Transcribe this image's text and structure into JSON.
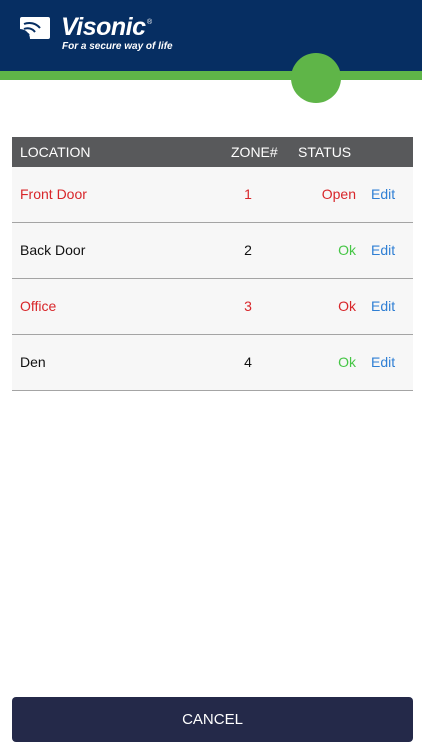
{
  "header": {
    "brand_name": "Visonic",
    "brand_reg": "®",
    "tagline": "For a secure way of life",
    "colors": {
      "background": "#062e62",
      "accent": "#5fb548"
    }
  },
  "table": {
    "columns": {
      "location": "LOCATION",
      "zone": "ZONE#",
      "status": "STATUS"
    },
    "rows": [
      {
        "location": "Front Door",
        "zone": "1",
        "status": "Open",
        "action": "Edit",
        "alarm": true
      },
      {
        "location": "Back Door",
        "zone": "2",
        "status": "Ok",
        "action": "Edit",
        "alarm": false
      },
      {
        "location": "Office",
        "zone": "3",
        "status": "Ok",
        "action": "Edit",
        "alarm": true
      },
      {
        "location": "Den",
        "zone": "4",
        "status": "Ok",
        "action": "Edit",
        "alarm": false
      }
    ],
    "colors": {
      "alarm_text": "#d8262a",
      "ok_status": "#46c646",
      "edit_link": "#2f7fd4",
      "header_bg": "#58595b"
    }
  },
  "footer": {
    "cancel_label": "CANCEL",
    "cancel_bg": "#242949"
  }
}
